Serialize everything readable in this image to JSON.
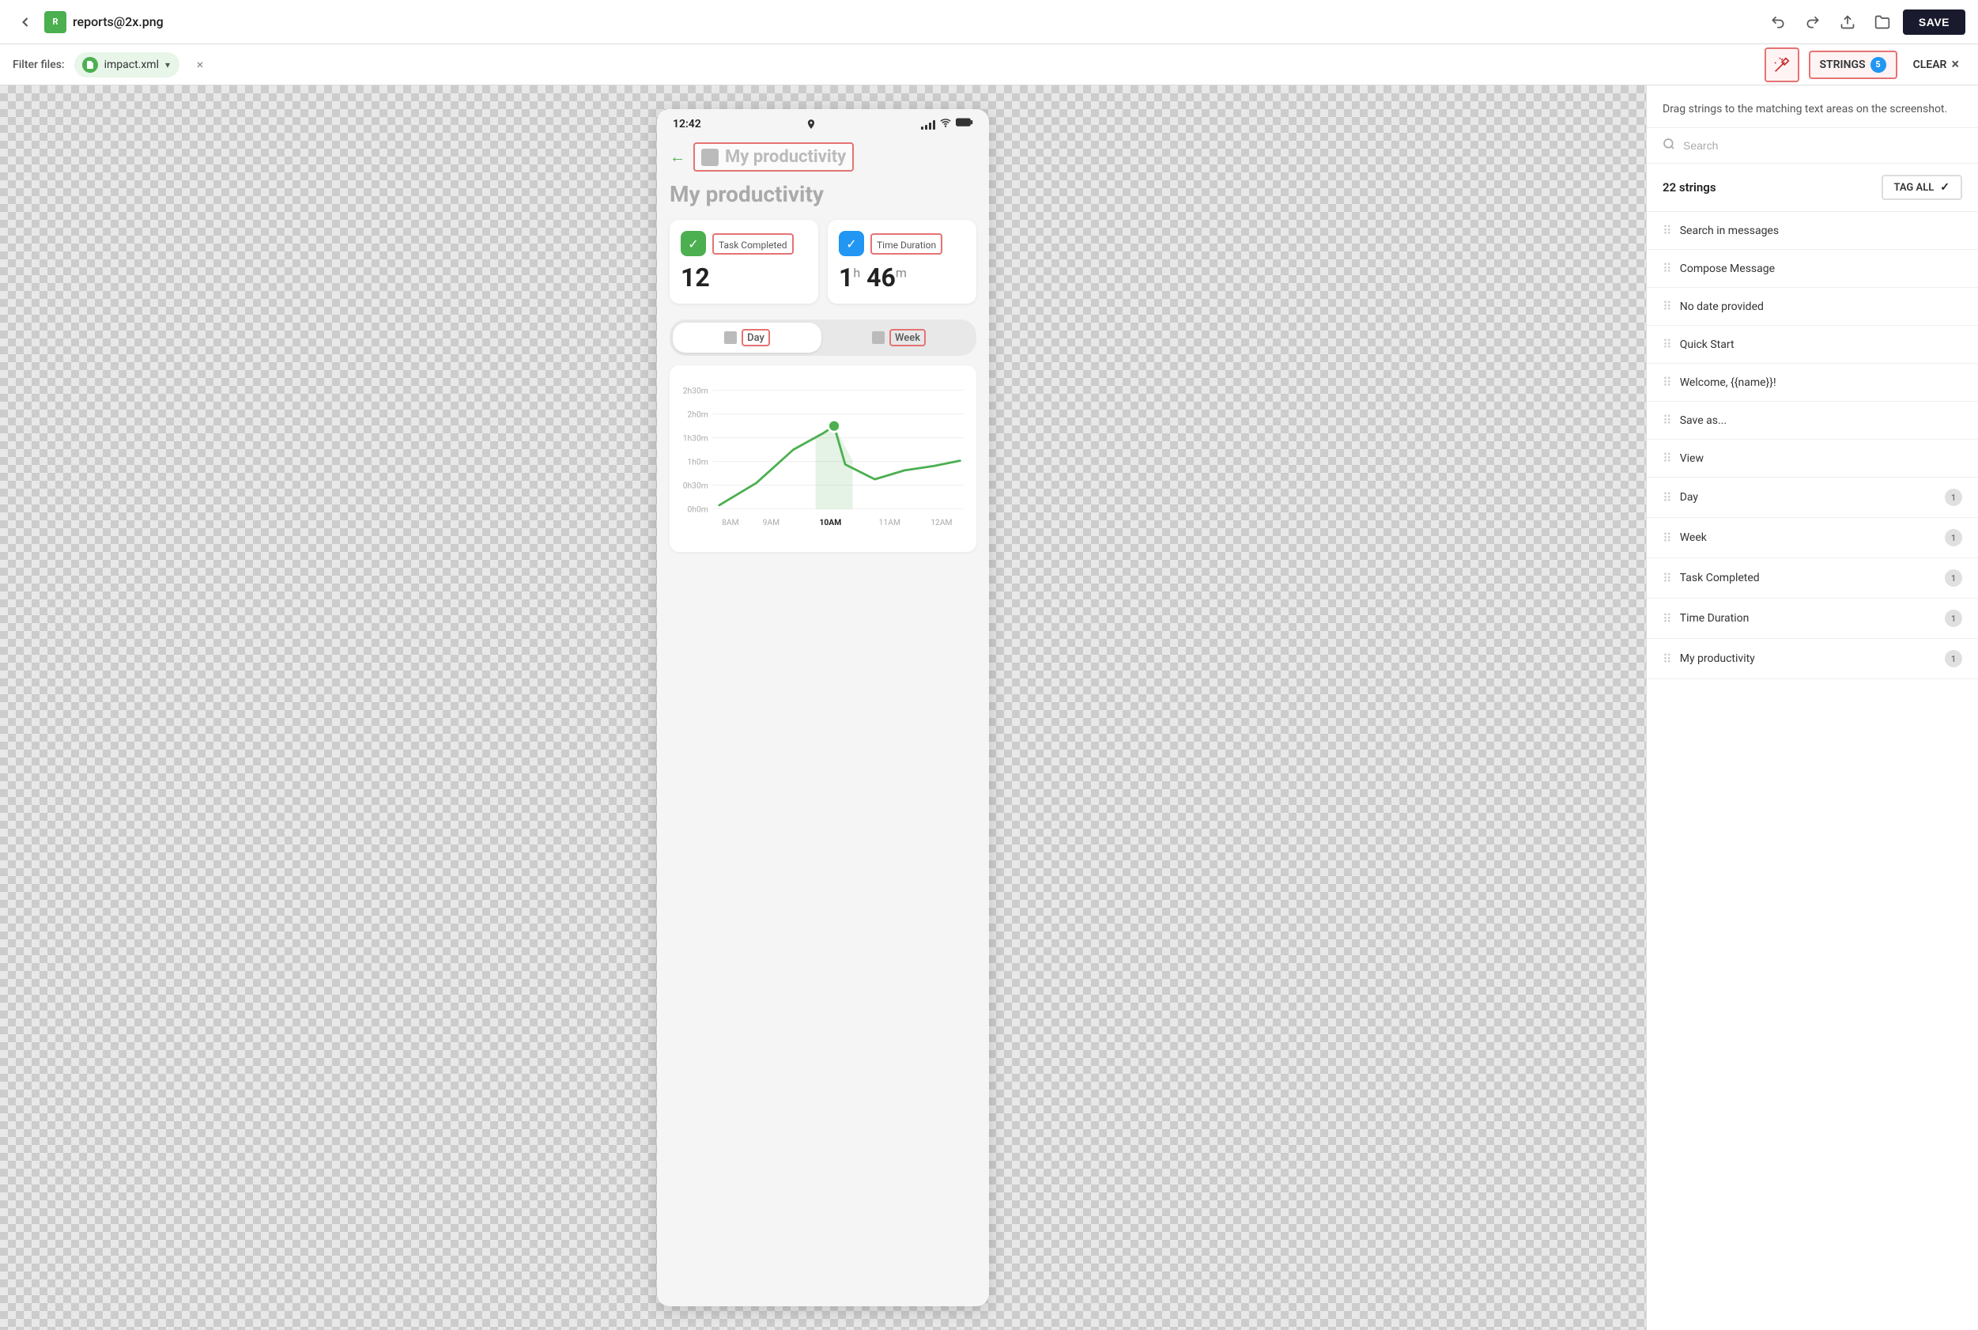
{
  "topbar": {
    "back_label": "←",
    "file_icon_label": "R",
    "title": "reports@2x.png",
    "undo_label": "↩",
    "redo_label": "↪",
    "upload_label": "⬆",
    "folder_label": "▢",
    "save_label": "SAVE"
  },
  "filterbar": {
    "filter_label": "Filter files:",
    "selected_file": "impact.xml",
    "close_label": "×",
    "wand_label": "✦",
    "strings_label": "STRINGS",
    "strings_count": "5",
    "clear_label": "CLEAR",
    "clear_x": "×"
  },
  "panel": {
    "description": "Drag strings to the matching text areas on the screenshot.",
    "search_placeholder": "Search",
    "count_text": "22 strings",
    "tag_all_label": "TAG ALL",
    "strings": [
      {
        "id": 1,
        "text": "Search in messages",
        "badge": null
      },
      {
        "id": 2,
        "text": "Compose Message",
        "badge": null
      },
      {
        "id": 3,
        "text": "No date provided",
        "badge": null
      },
      {
        "id": 4,
        "text": "Quick Start",
        "badge": null
      },
      {
        "id": 5,
        "text": "Welcome, {{name}}!",
        "badge": null
      },
      {
        "id": 6,
        "text": "Save as...",
        "badge": null
      },
      {
        "id": 7,
        "text": "View",
        "badge": null
      },
      {
        "id": 8,
        "text": "Day",
        "badge": "1"
      },
      {
        "id": 9,
        "text": "Week",
        "badge": "1"
      },
      {
        "id": 10,
        "text": "Task Completed",
        "badge": "1"
      },
      {
        "id": 11,
        "text": "Time Duration",
        "badge": "1"
      },
      {
        "id": 12,
        "text": "My productivity",
        "badge": "1"
      }
    ]
  },
  "phone": {
    "time": "12:42",
    "title": "My productivity",
    "task_completed_label": "Task Completed",
    "task_completed_value": "12",
    "time_duration_label": "Time Duration",
    "time_duration_hours": "1",
    "time_duration_mins": "46",
    "tab_day": "Day",
    "tab_week": "Week",
    "chart": {
      "y_labels": [
        "2h30m",
        "2h0m",
        "1h30m",
        "1h0m",
        "0h30m",
        "0h0m"
      ],
      "x_labels": [
        "8AM",
        "9AM",
        "10AM",
        "11AM",
        "12AM"
      ],
      "current_label": "10AM"
    }
  }
}
